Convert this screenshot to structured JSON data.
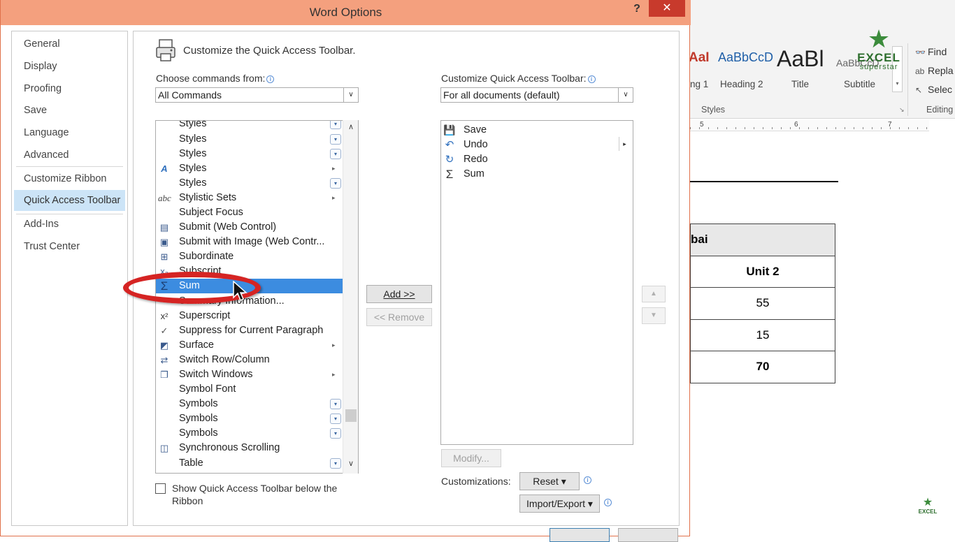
{
  "dialog": {
    "title": "Word Options",
    "help_label": "?",
    "close_label": "✕"
  },
  "nav": {
    "items": [
      {
        "label": "General"
      },
      {
        "label": "Display"
      },
      {
        "label": "Proofing"
      },
      {
        "label": "Save"
      },
      {
        "label": "Language"
      },
      {
        "label": "Advanced"
      },
      {
        "label": "Customize Ribbon"
      },
      {
        "label": "Quick Access Toolbar"
      },
      {
        "label": "Add-Ins"
      },
      {
        "label": "Trust Center"
      }
    ],
    "selected": "Quick Access Toolbar"
  },
  "main": {
    "header": "Customize the Quick Access Toolbar.",
    "choose_label": "Choose commands from:",
    "choose_value": "All Commands",
    "customize_label": "Customize Quick Access Toolbar:",
    "customize_value": "For all documents (default)",
    "commands": [
      {
        "label": "Styles",
        "icon": "",
        "extra": "dropdown"
      },
      {
        "label": "Styles",
        "icon": "",
        "extra": "dropdown"
      },
      {
        "label": "Styles",
        "icon": "",
        "extra": "dropdown"
      },
      {
        "label": "Styles",
        "icon": "styles-icon",
        "extra": "submenu"
      },
      {
        "label": "Styles",
        "icon": "",
        "extra": "dropdown"
      },
      {
        "label": "Stylistic Sets",
        "icon": "abc-icon",
        "extra": "submenu"
      },
      {
        "label": "Subject Focus",
        "icon": "",
        "extra": ""
      },
      {
        "label": "Submit (Web Control)",
        "icon": "web-control-icon",
        "extra": ""
      },
      {
        "label": "Submit with Image (Web Contr...",
        "icon": "image-icon",
        "extra": ""
      },
      {
        "label": "Subordinate",
        "icon": "org-chart-icon",
        "extra": ""
      },
      {
        "label": "Subscript",
        "icon": "subscript-icon",
        "extra": ""
      },
      {
        "label": "Sum",
        "icon": "sigma-icon",
        "extra": ""
      },
      {
        "label": "Summary Information...",
        "icon": "",
        "extra": ""
      },
      {
        "label": "Superscript",
        "icon": "superscript-icon",
        "extra": ""
      },
      {
        "label": "Suppress for Current Paragraph",
        "icon": "check-icon",
        "extra": ""
      },
      {
        "label": "Surface",
        "icon": "surface-icon",
        "extra": "submenu"
      },
      {
        "label": "Switch Row/Column",
        "icon": "switch-row-column-icon",
        "extra": ""
      },
      {
        "label": "Switch Windows",
        "icon": "switch-windows-icon",
        "extra": "submenu"
      },
      {
        "label": "Symbol Font",
        "icon": "",
        "extra": ""
      },
      {
        "label": "Symbols",
        "icon": "",
        "extra": "dropdown"
      },
      {
        "label": "Symbols",
        "icon": "",
        "extra": "dropdown"
      },
      {
        "label": "Symbols",
        "icon": "",
        "extra": "dropdown"
      },
      {
        "label": "Synchronous Scrolling",
        "icon": "sync-scroll-icon",
        "extra": ""
      },
      {
        "label": "Table",
        "icon": "",
        "extra": "dropdown"
      }
    ],
    "selected_command": "Sum",
    "add_button": "Add >>",
    "remove_button": "<< Remove",
    "qat_items": [
      {
        "label": "Save",
        "icon": "save-icon"
      },
      {
        "label": "Undo",
        "icon": "undo-icon"
      },
      {
        "label": "Redo",
        "icon": "redo-icon"
      },
      {
        "label": "Sum",
        "icon": "sigma-icon"
      }
    ],
    "modify_button": "Modify...",
    "customizations_label": "Customizations:",
    "reset_button": "Reset ▾",
    "import_export_button": "Import/Export ▾",
    "show_below_label": "Show Quick Access Toolbar below the Ribbon",
    "show_below_checked": false
  },
  "word": {
    "style_samples": [
      "AaI",
      "AaBbCcD",
      "AaBl",
      "AaBbCcD"
    ],
    "style_names": [
      "ng 1",
      "Heading 2",
      "Title",
      "Subtitle"
    ],
    "styles_group": "Styles",
    "editing_group": "Editing",
    "edit_commands": [
      "Find",
      "Repla",
      "Selec"
    ],
    "ruler_numbers": [
      "5",
      "6",
      "7"
    ],
    "table": {
      "header": "bai",
      "col_header": "Unit 2",
      "values": [
        "55",
        "15",
        "70"
      ]
    },
    "logo": {
      "text": "EXCEL",
      "sub": "superstar"
    },
    "logo_small": {
      "text": "EXCEL"
    }
  },
  "colors": {
    "titlebar": "#f4a07e",
    "close": "#c83a2c",
    "selection": "#3c8ce0",
    "nav_selected": "#cce4f7",
    "annotation": "#d52423"
  }
}
